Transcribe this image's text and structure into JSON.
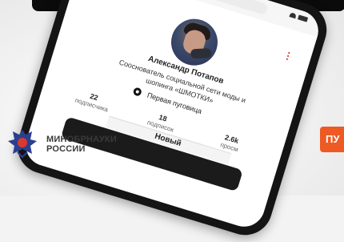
{
  "url": "lnder_shmotki",
  "profile": {
    "name": "Александр Потапов",
    "bio": "Сооснователь социальной сети моды и шопинга «ШМОТКИ»",
    "link_text": "Первая пуговица",
    "more_symbol": "⋮"
  },
  "stats": [
    {
      "value": "22",
      "label": "подписчика"
    },
    {
      "value": "18",
      "label": "подписок"
    },
    {
      "value": "2.6k",
      "label": "просм"
    }
  ],
  "tab": {
    "label": "Новый"
  },
  "ministry": {
    "line1": "МИНОБРНАУКИ",
    "line2": "РОССИИ"
  },
  "side_button": {
    "label": "ПУ"
  },
  "colors": {
    "accent": "#ee5a24",
    "phone": "#141414"
  }
}
